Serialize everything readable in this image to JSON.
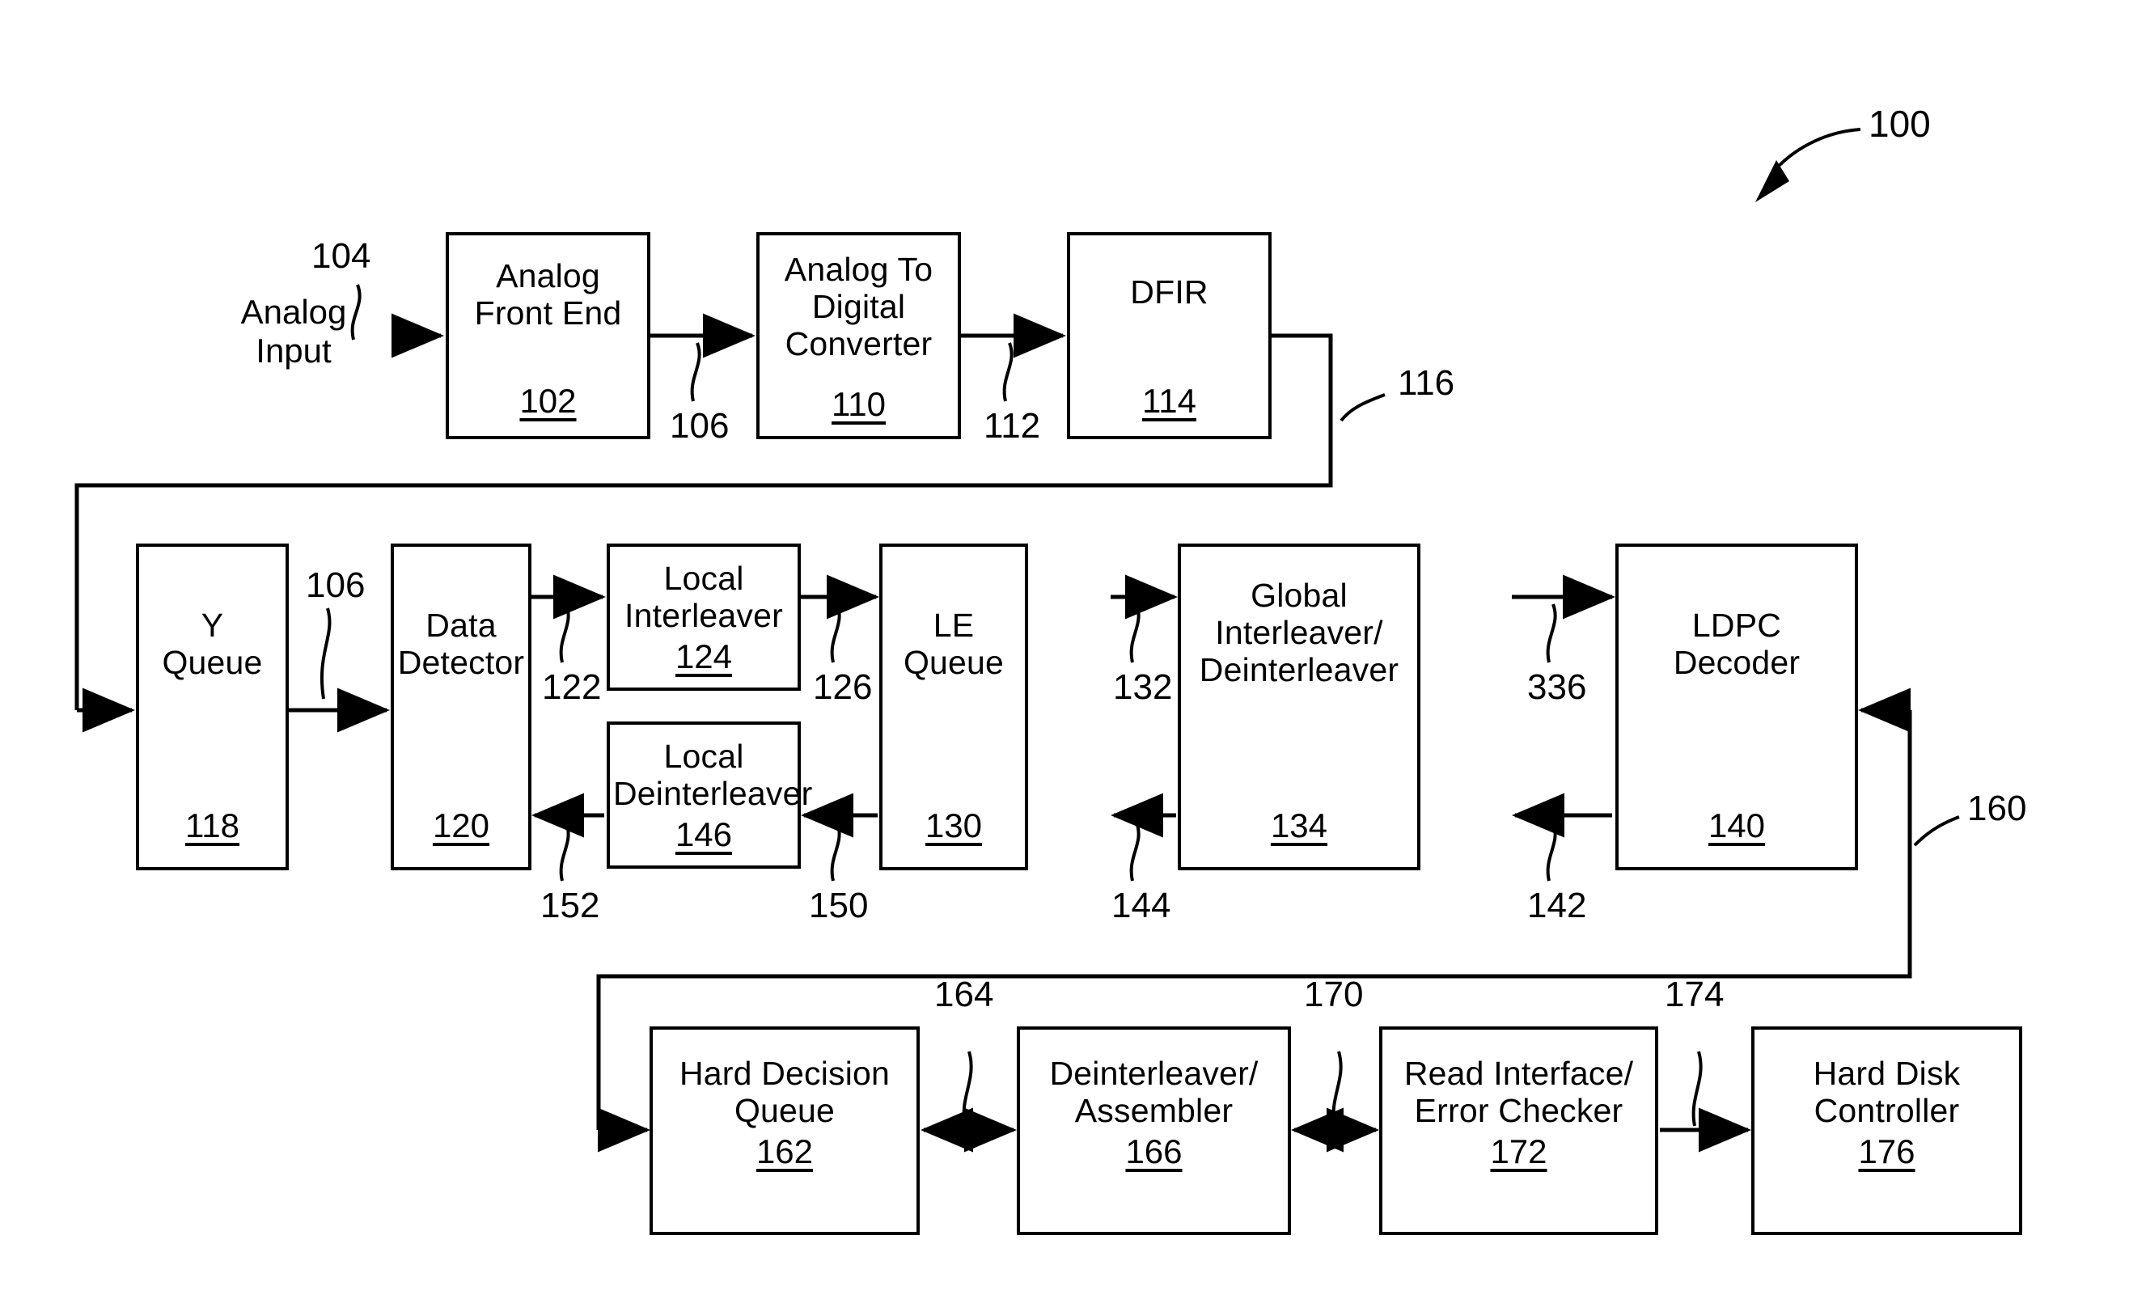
{
  "figure": {
    "number": "100",
    "type": "block-diagram",
    "input_label": "Analog\nInput"
  },
  "blocks": [
    {
      "id": "afe",
      "title": "Analog\nFront End",
      "ref": "102",
      "layout": "split"
    },
    {
      "id": "adc",
      "title": "Analog To\nDigital\nConverter",
      "ref": "110",
      "layout": "split"
    },
    {
      "id": "dfir",
      "title": "DFIR",
      "ref": "114",
      "layout": "split"
    },
    {
      "id": "yq",
      "title": "Y\nQueue",
      "ref": "118",
      "layout": "split"
    },
    {
      "id": "dd",
      "title": "Data\nDetector",
      "ref": "120",
      "layout": "split"
    },
    {
      "id": "li",
      "title": "Local\nInterleaver",
      "ref": "124",
      "layout": "stack"
    },
    {
      "id": "ldi",
      "title": "Local\nDeinterleaver",
      "ref": "146",
      "layout": "stack"
    },
    {
      "id": "leq",
      "title": "LE\nQueue",
      "ref": "130",
      "layout": "split"
    },
    {
      "id": "gid",
      "title": "Global\nInterleaver/\nDeinterleaver",
      "ref": "134",
      "layout": "split"
    },
    {
      "id": "ldpc",
      "title": "LDPC\nDecoder",
      "ref": "140",
      "layout": "split"
    },
    {
      "id": "hdq",
      "title": "Hard Decision\nQueue",
      "ref": "162",
      "layout": "stack"
    },
    {
      "id": "da",
      "title": "Deinterleaver/\nAssembler",
      "ref": "166",
      "layout": "stack"
    },
    {
      "id": "rie",
      "title": "Read Interface/\nError Checker",
      "ref": "172",
      "layout": "stack"
    },
    {
      "id": "hdc",
      "title": "Hard Disk\nController",
      "ref": "176",
      "layout": "stack"
    }
  ],
  "signals": [
    {
      "id": "s104",
      "label": "104"
    },
    {
      "id": "s106a",
      "label": "106"
    },
    {
      "id": "s112",
      "label": "112"
    },
    {
      "id": "s116",
      "label": "116"
    },
    {
      "id": "s106b",
      "label": "106"
    },
    {
      "id": "s122",
      "label": "122"
    },
    {
      "id": "s126",
      "label": "126"
    },
    {
      "id": "s132",
      "label": "132"
    },
    {
      "id": "s336",
      "label": "336"
    },
    {
      "id": "s152",
      "label": "152"
    },
    {
      "id": "s150",
      "label": "150"
    },
    {
      "id": "s144",
      "label": "144"
    },
    {
      "id": "s142",
      "label": "142"
    },
    {
      "id": "s160",
      "label": "160"
    },
    {
      "id": "s164",
      "label": "164"
    },
    {
      "id": "s170",
      "label": "170"
    },
    {
      "id": "s174",
      "label": "174"
    }
  ]
}
